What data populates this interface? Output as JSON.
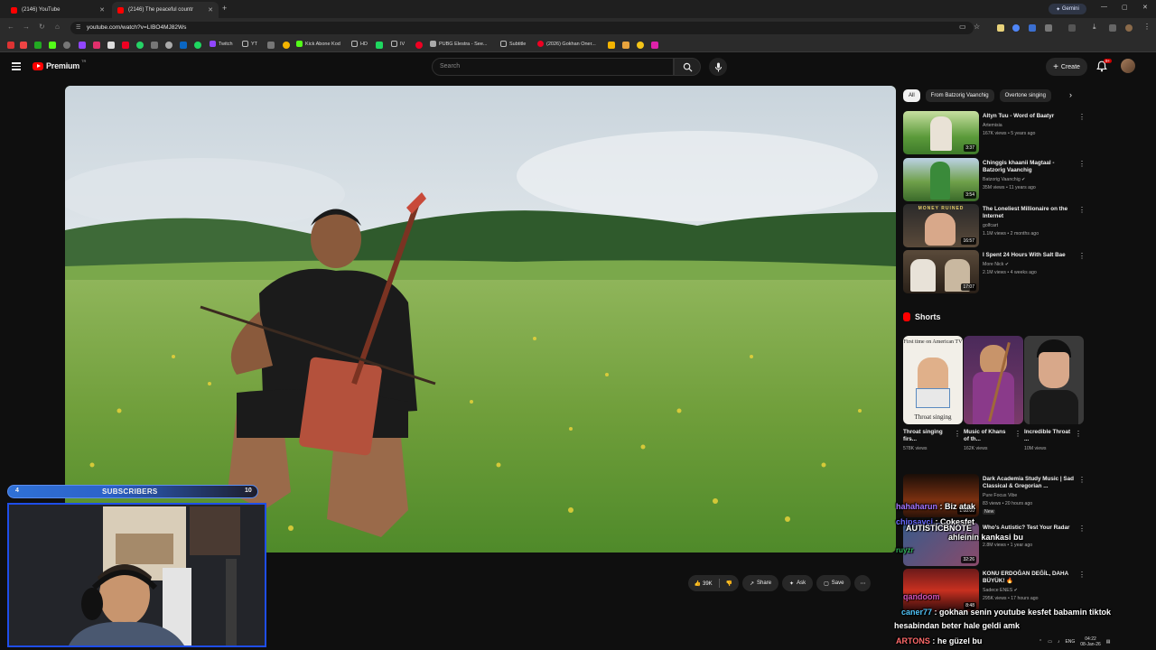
{
  "browser": {
    "tabs": [
      {
        "title": "(2146) YouTube",
        "active": false
      },
      {
        "title": "(2146) The peaceful countr",
        "active": true
      }
    ],
    "gemini_label": "Gemini",
    "url": "youtube.com/watch?v=LIBO4MJ82Ws",
    "bookmarks": [
      "Twitch",
      "YT",
      "Kick Abone Kod",
      "HD",
      "IV",
      "PUBG Elestra - See...",
      "Subtitle",
      "(2026) Gokhan Oner..."
    ]
  },
  "header": {
    "logo_text": "Premium",
    "logo_superscript": "TR",
    "search_placeholder": "Search",
    "create_label": "Create",
    "notification_count": "9+"
  },
  "actions": {
    "like_count": "39K",
    "share_label": "Share",
    "ask_label": "Ask",
    "save_label": "Save"
  },
  "chips": [
    "All",
    "From Batzorig Vaanchig",
    "Overtone singing"
  ],
  "recommendations": [
    {
      "title": "Altyn Tuu - Word of Baatyr",
      "channel": "Artemisia",
      "meta": "167K views • 5 years ago",
      "duration": "3:37",
      "verified": false
    },
    {
      "title": "Chinggis khaanii Magtaal - Batzorig Vaanchig",
      "channel": "Batzorig Vaanchig",
      "meta": "35M views • 11 years ago",
      "duration": "3:54",
      "verified": true
    },
    {
      "title": "The Loneliest Millionaire on the Internet",
      "channel": "golfcart",
      "meta": "1.1M views • 2 months ago",
      "duration": "16:57",
      "verified": false,
      "thumb_text": "MONEY RUINED"
    },
    {
      "title": "I Spent 24 Hours With Salt Bae",
      "channel": "More Nick",
      "meta": "2.1M views • 4 weeks ago",
      "duration": "17:07",
      "verified": true
    },
    {
      "title": "Dark Academia Study Music | Sad Classical & Gregorian ...",
      "channel": "Pure Focus Vibe",
      "meta": "83 views • 20 hours ago",
      "duration": "1:08:00",
      "badge": "New"
    },
    {
      "title": "Who's Autistic? Test Your Radar",
      "channel": "Jubilee",
      "meta": "2.8M views • 1 year ago",
      "duration": "32:26"
    },
    {
      "title": "KONU ERDOĞAN DEĞİL, DAHA BÜYÜK! 🔥",
      "channel": "Sadece ENES",
      "meta": "295K views • 17 hours ago",
      "duration": "8:48",
      "verified": true
    }
  ],
  "shorts": {
    "heading": "Shorts",
    "items": [
      {
        "title": "Throat singing firs...",
        "views": "578K views",
        "thumb_top": "First time on American TV",
        "thumb_bottom": "Throat singing"
      },
      {
        "title": "Music of Khans of th...",
        "views": "162K views"
      },
      {
        "title": "Incredible Throat ...",
        "views": "10M views"
      }
    ]
  },
  "overlay": {
    "subs_left": "4",
    "subs_label": "SUBSCRIBERS",
    "subs_right": "10"
  },
  "chat": [
    {
      "user": "hahaharun",
      "text": "Biz atak",
      "user_color": "#a575ff"
    },
    {
      "user": "chipsavci",
      "text": "Cokesfet",
      "user_color": "#6b6bff"
    },
    {
      "user": "AUTISTICBNOTE",
      "text": "ahleinin kankasi bu",
      "user_color": "#ffffff"
    },
    {
      "user": "ruyzr",
      "text": "",
      "user_color": "#2fb35a"
    },
    {
      "user": "qandoom",
      "text": "",
      "user_color": "#d254b8"
    },
    {
      "user": "caner77",
      "text": "gokhan senin youtube kesfet babamin tiktok",
      "user_color": "#4fc3f7"
    },
    {
      "user": "",
      "text": "hesabindan beter hale geldi amk",
      "user_color": "#ffffff"
    },
    {
      "user": "ARTONS",
      "text": "he güzel bu",
      "user_color": "#ff6a6a"
    }
  ],
  "systray": {
    "lang": "ENG",
    "time": "04:22",
    "date": "08-Jan-26"
  }
}
